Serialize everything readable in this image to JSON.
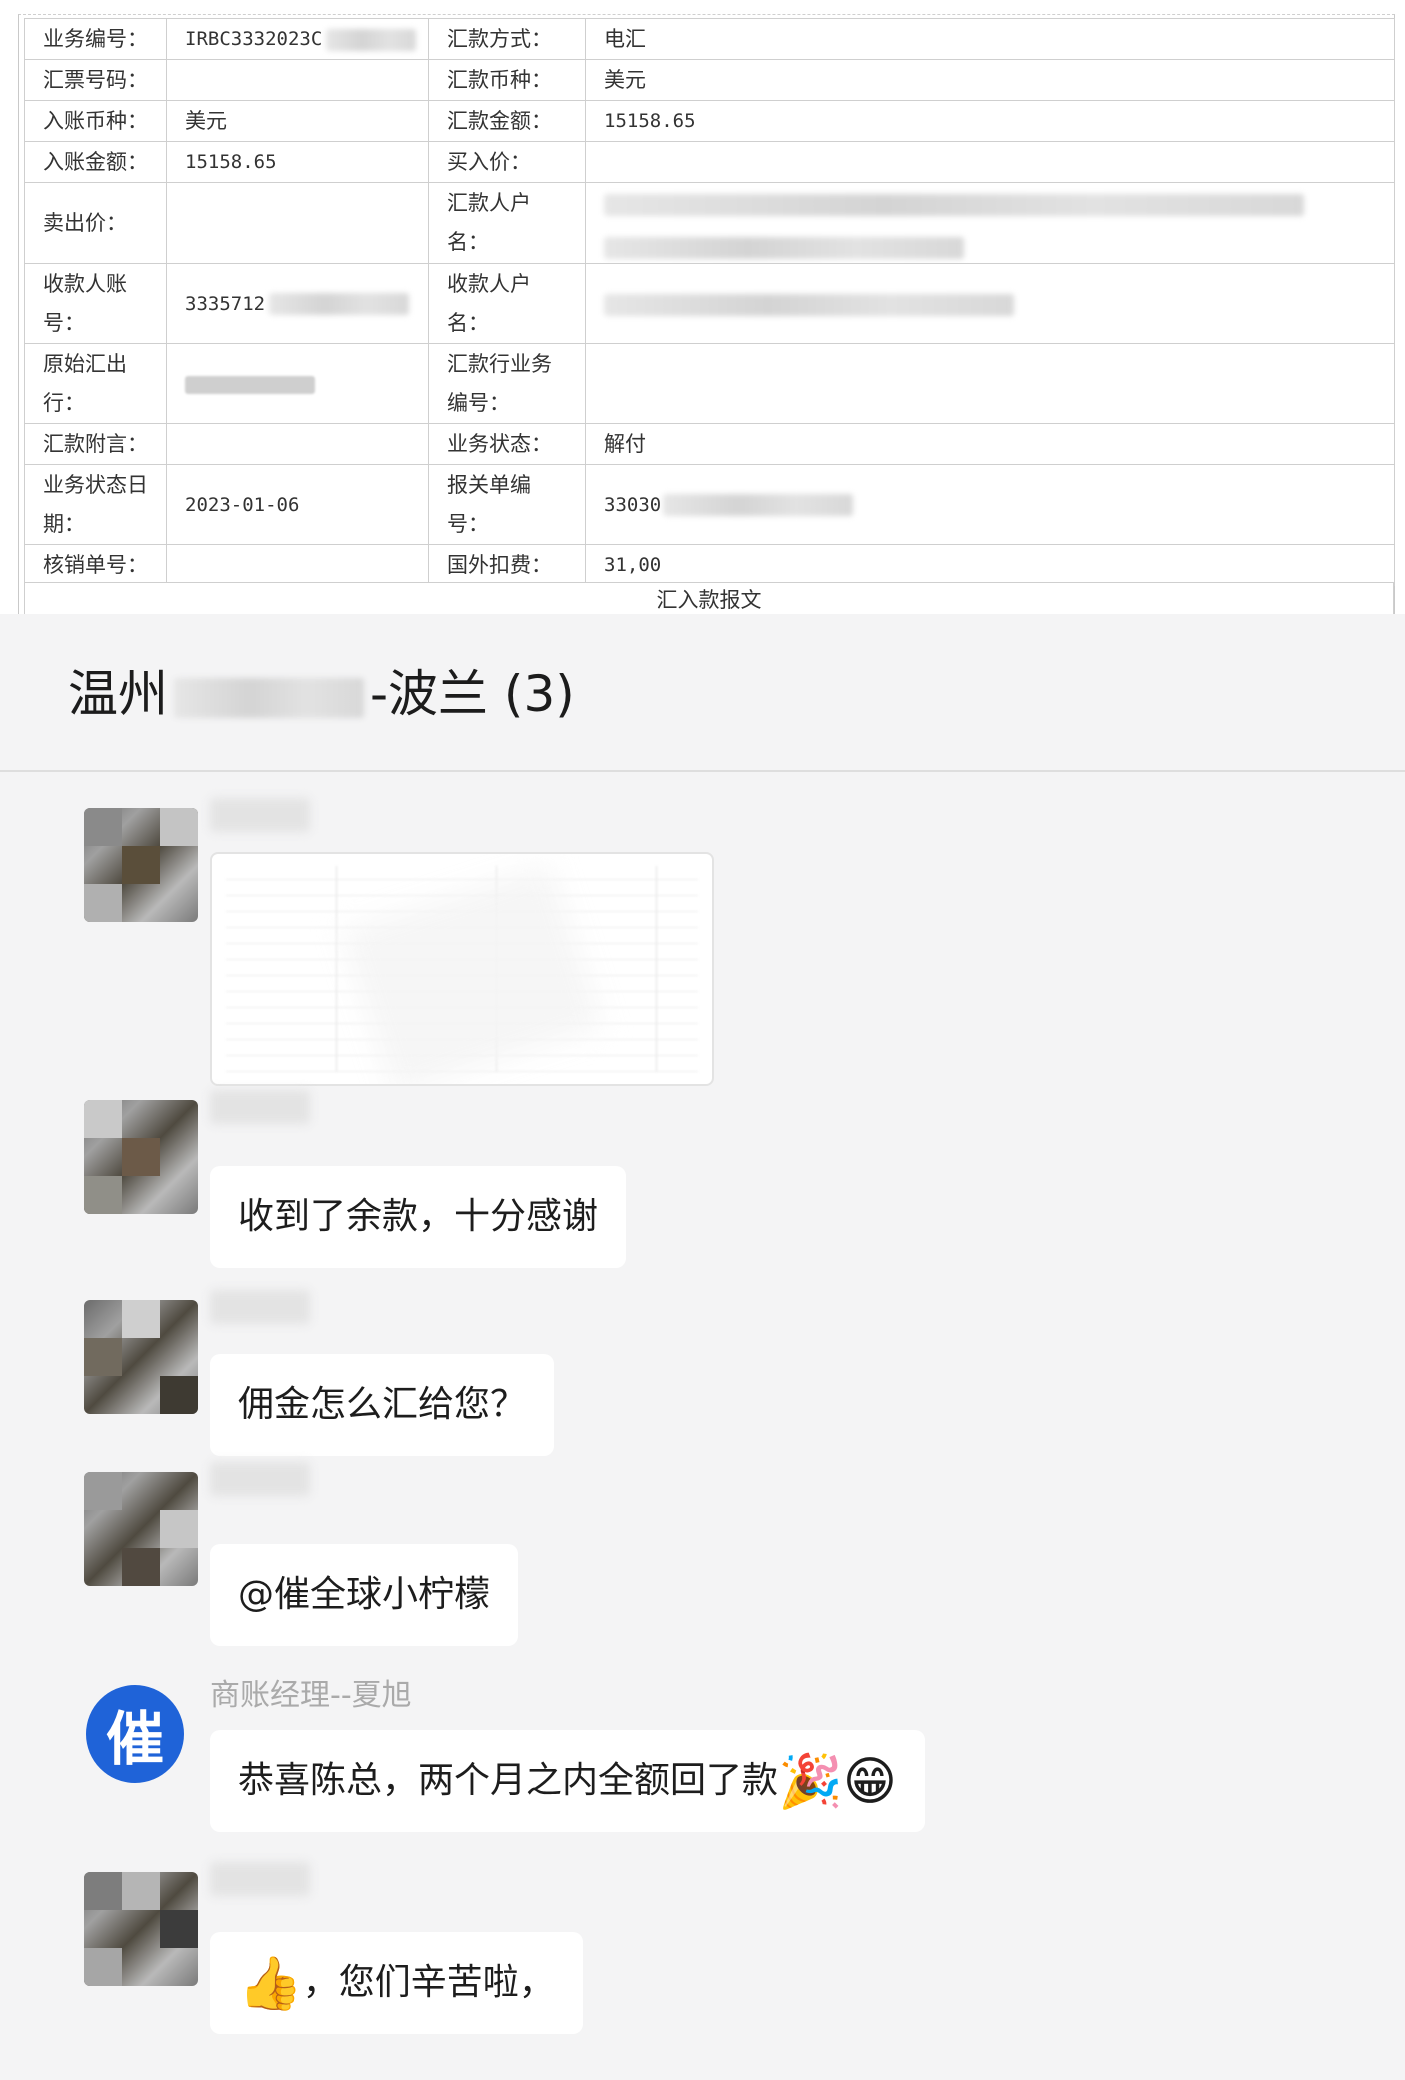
{
  "record": {
    "rows": [
      {
        "l1": "业务编号：",
        "v1": "IRBC3332023C",
        "l2": "汇款方式：",
        "v2": "电汇"
      },
      {
        "l1": "汇票号码：",
        "v1": "",
        "l2": "汇款币种：",
        "v2": "美元"
      },
      {
        "l1": "入账币种：",
        "v1": "美元",
        "l2": "汇款金额：",
        "v2": "15158.65"
      },
      {
        "l1": "入账金额：",
        "v1": "15158.65",
        "l2": "买入价：",
        "v2": ""
      },
      {
        "l1": "卖出价：",
        "v1": "",
        "l2": "汇款人户名：",
        "v2": ""
      },
      {
        "l1": "收款人账号：",
        "v1": "3335712",
        "l2": "收款人户名：",
        "v2": ""
      },
      {
        "l1": "原始汇出行：",
        "v1": "",
        "l2": "汇款行业务编号：",
        "v2": ""
      },
      {
        "l1": "汇款附言：",
        "v1": "",
        "l2": "业务状态：",
        "v2": "解付"
      },
      {
        "l1": "业务状态日期：",
        "v1": "2023-01-06",
        "l2": "报关单编号：",
        "v2": "33030"
      },
      {
        "l1": "核销单号：",
        "v1": "",
        "l2": "国外扣费：",
        "v2": "31,00"
      }
    ],
    "footer": "汇入款报文"
  },
  "chat": {
    "title_prefix": "温州",
    "title_suffix": "-波兰 (3)",
    "messages": [
      {
        "type": "image"
      },
      {
        "type": "text",
        "text": "收到了余款，十分感谢"
      },
      {
        "type": "text",
        "text": "佣金怎么汇给您？"
      },
      {
        "type": "text",
        "text": "@催全球小柠檬"
      },
      {
        "type": "text",
        "sender": "商账经理--夏旭",
        "avatar_char": "催",
        "text": "恭喜陈总，两个月之内全额回了款",
        "emoji_1": "🎉",
        "emoji_2": "😁"
      },
      {
        "type": "text",
        "emoji_lead": "👍",
        "text": "，您们辛苦啦，"
      }
    ]
  },
  "colors": {
    "brand_avatar": "#1f63d8",
    "page_bg": "#f4f4f5",
    "bubble_bg": "#ffffff"
  }
}
